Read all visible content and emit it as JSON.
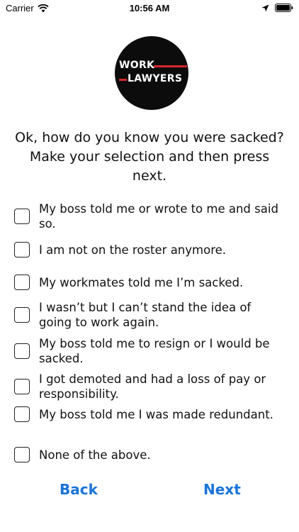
{
  "status_bar": {
    "carrier": "Carrier",
    "time": "10:56 AM",
    "icons": [
      "wifi-icon",
      "location-arrow-icon",
      "battery-icon"
    ]
  },
  "logo": {
    "line1": "WORK",
    "line2": "LAWYERS",
    "colors": {
      "background": "#0c0c0c",
      "text": "#ffffff",
      "accent": "#d7262e"
    }
  },
  "question": "Ok, how do you know you were sacked?  Make your selection and then press next.",
  "options": [
    {
      "label": "My boss told me or wrote to me and said so.",
      "checked": false
    },
    {
      "label": "I am not on the roster anymore.",
      "checked": false
    },
    {
      "label": "My workmates told me I’m sacked.",
      "checked": false
    },
    {
      "label": "I wasn’t but I can’t stand the idea of going to work again.",
      "checked": false
    },
    {
      "label": "My boss told me to resign or I would be sacked.",
      "checked": false
    },
    {
      "label": "I got demoted and had a loss of pay or responsibility.",
      "checked": false
    },
    {
      "label": "My boss told me I was made redundant.",
      "checked": false
    },
    {
      "label": "None of the above.",
      "checked": false
    }
  ],
  "nav": {
    "back_label": "Back",
    "next_label": "Next",
    "accent_color": "#1a74d8"
  }
}
